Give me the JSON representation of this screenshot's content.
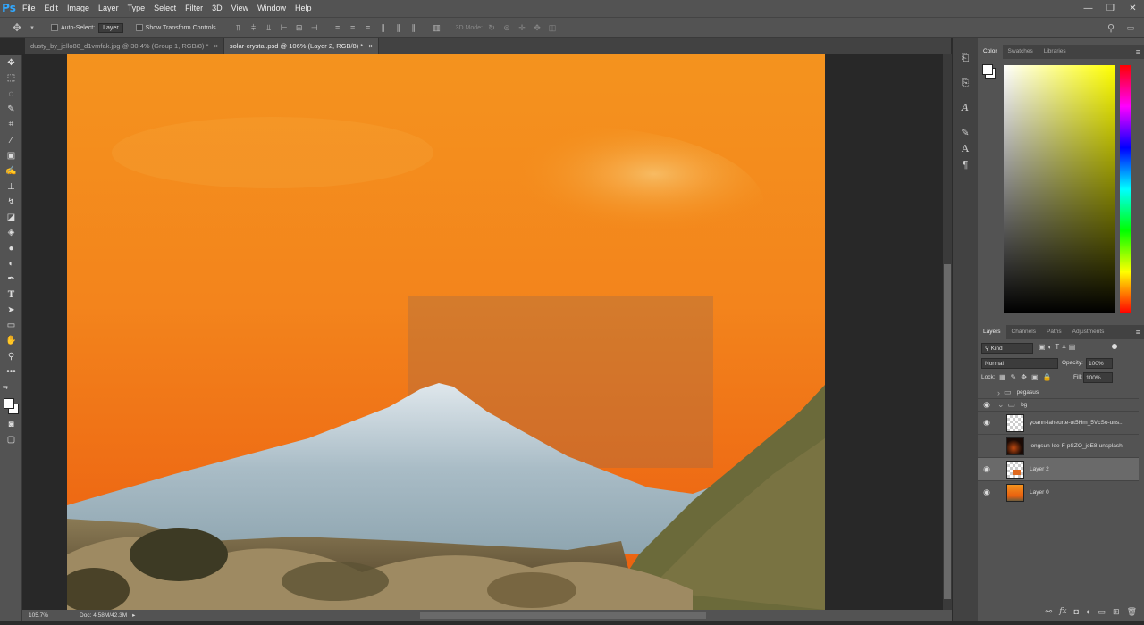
{
  "app": {
    "logo": "Ps",
    "menus": [
      "File",
      "Edit",
      "Image",
      "Layer",
      "Type",
      "Select",
      "Filter",
      "3D",
      "View",
      "Window",
      "Help"
    ],
    "window_controls": [
      "—",
      "❐",
      "✕"
    ]
  },
  "options_bar": {
    "auto_select_label": "Auto-Select:",
    "auto_select_value": "Layer",
    "show_transform_label": "Show Transform Controls",
    "mode_3d_label": "3D Mode:"
  },
  "tabs": [
    {
      "label": "dusty_by_jello88_d1vmfak.jpg @ 30.4% (Group 1, RGB/8) *",
      "close": "×"
    },
    {
      "label": "solar-crystal.psd @ 106% (Layer 2, RGB/8) *",
      "close": "×"
    }
  ],
  "status": {
    "zoom": "105.7%",
    "doc": "Doc: 4.58M/42.3M"
  },
  "color_panel": {
    "tabs": [
      "Color",
      "Swatches",
      "Libraries"
    ]
  },
  "layers_panel": {
    "tabs": [
      "Layers",
      "Channels",
      "Paths",
      "Adjustments"
    ],
    "filter_kind": "Kind",
    "blend_mode": "Normal",
    "opacity_label": "Opacity:",
    "opacity_value": "100%",
    "lock_label": "Lock:",
    "fill_label": "Fill:",
    "fill_value": "100%",
    "layers": [
      {
        "name": "pegasus",
        "type": "group",
        "visible": false
      },
      {
        "name": "bg",
        "type": "group",
        "visible": true
      },
      {
        "name": "yoann-laheurte-ut5Hm_5VcSo-uns...",
        "type": "layer",
        "visible": true
      },
      {
        "name": "jongsun-lee-F-pSZO_jeE8-unsplash",
        "type": "layer",
        "visible": false
      },
      {
        "name": "Layer 2",
        "type": "layer",
        "visible": true
      },
      {
        "name": "Layer 0",
        "type": "layer",
        "visible": true
      }
    ]
  },
  "colors": {
    "accent": "#31a8ff",
    "ui_bg": "#535353",
    "canvas_sky": "#f07a1c"
  }
}
